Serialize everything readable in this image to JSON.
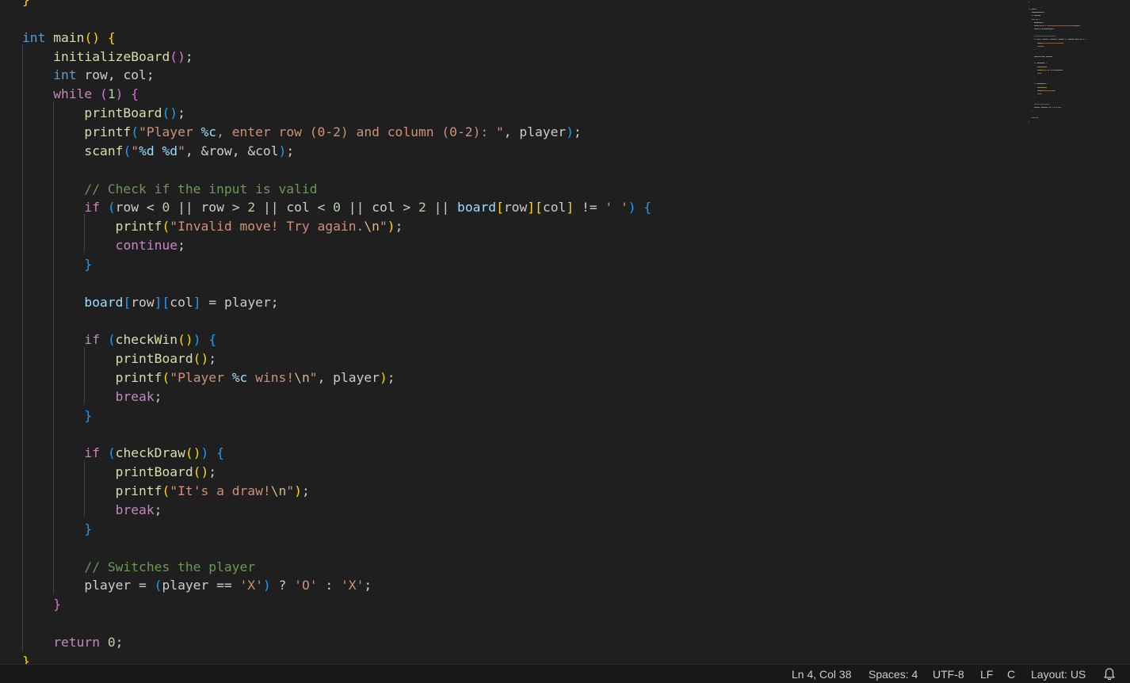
{
  "colors": {
    "keyword_type": "#569cd6",
    "control": "#c586c0",
    "function": "#dcdcaa",
    "variable": "#9cdcfe",
    "string": "#ce9178",
    "number": "#b5cea8",
    "comment": "#6a9955",
    "plain": "#cccccc",
    "bracket1": "#ffd700",
    "bracket2": "#da70d6",
    "bracket3": "#179fff",
    "escape": "#d7ba7d"
  },
  "editor": {
    "lines": [
      [
        [
          "}",
          "bracket1"
        ]
      ],
      [],
      [
        [
          "int",
          "keyword_type"
        ],
        [
          " ",
          "plain"
        ],
        [
          "main",
          "function"
        ],
        [
          "()",
          "bracket1"
        ],
        [
          " ",
          "plain"
        ],
        [
          "{",
          "bracket1"
        ]
      ],
      [
        [
          "    ",
          "plain"
        ],
        [
          "initializeBoard",
          "function"
        ],
        [
          "()",
          "bracket2"
        ],
        [
          ";",
          "plain"
        ]
      ],
      [
        [
          "    ",
          "plain"
        ],
        [
          "int",
          "keyword_type"
        ],
        [
          " row, col;",
          "plain"
        ]
      ],
      [
        [
          "    ",
          "plain"
        ],
        [
          "while",
          "control"
        ],
        [
          " ",
          "plain"
        ],
        [
          "(",
          "bracket2"
        ],
        [
          "1",
          "number"
        ],
        [
          ")",
          "bracket2"
        ],
        [
          " ",
          "plain"
        ],
        [
          "{",
          "bracket2"
        ]
      ],
      [
        [
          "        ",
          "plain"
        ],
        [
          "printBoard",
          "function"
        ],
        [
          "()",
          "bracket3"
        ],
        [
          ";",
          "plain"
        ]
      ],
      [
        [
          "        ",
          "plain"
        ],
        [
          "printf",
          "function"
        ],
        [
          "(",
          "bracket3"
        ],
        [
          "\"Player ",
          "string"
        ],
        [
          "%c",
          "variable"
        ],
        [
          ", enter row (0-2) and column (0-2): \"",
          "string"
        ],
        [
          ", player",
          "plain"
        ],
        [
          ")",
          "bracket3"
        ],
        [
          ";",
          "plain"
        ]
      ],
      [
        [
          "        ",
          "plain"
        ],
        [
          "scanf",
          "function"
        ],
        [
          "(",
          "bracket3"
        ],
        [
          "\"",
          "string"
        ],
        [
          "%d",
          "variable"
        ],
        [
          " ",
          "string"
        ],
        [
          "%d",
          "variable"
        ],
        [
          "\"",
          "string"
        ],
        [
          ", &row, &col",
          "plain"
        ],
        [
          ")",
          "bracket3"
        ],
        [
          ";",
          "plain"
        ]
      ],
      [],
      [
        [
          "        ",
          "plain"
        ],
        [
          "// Check if the input is valid",
          "comment"
        ]
      ],
      [
        [
          "        ",
          "plain"
        ],
        [
          "if",
          "control"
        ],
        [
          " ",
          "plain"
        ],
        [
          "(",
          "bracket3"
        ],
        [
          "row < ",
          "plain"
        ],
        [
          "0",
          "number"
        ],
        [
          " || row > ",
          "plain"
        ],
        [
          "2",
          "number"
        ],
        [
          " || col < ",
          "plain"
        ],
        [
          "0",
          "number"
        ],
        [
          " || col > ",
          "plain"
        ],
        [
          "2",
          "number"
        ],
        [
          " || ",
          "plain"
        ],
        [
          "board",
          "variable"
        ],
        [
          "[",
          "bracket1"
        ],
        [
          "row",
          "plain"
        ],
        [
          "]",
          "bracket1"
        ],
        [
          "[",
          "bracket1"
        ],
        [
          "col",
          "plain"
        ],
        [
          "]",
          "bracket1"
        ],
        [
          " != ",
          "plain"
        ],
        [
          "' '",
          "string"
        ],
        [
          ")",
          "bracket3"
        ],
        [
          " ",
          "plain"
        ],
        [
          "{",
          "bracket3"
        ]
      ],
      [
        [
          "            ",
          "plain"
        ],
        [
          "printf",
          "function"
        ],
        [
          "(",
          "bracket1"
        ],
        [
          "\"Invalid move! Try again.",
          "string"
        ],
        [
          "\\n",
          "escape"
        ],
        [
          "\"",
          "string"
        ],
        [
          ")",
          "bracket1"
        ],
        [
          ";",
          "plain"
        ]
      ],
      [
        [
          "            ",
          "plain"
        ],
        [
          "continue",
          "control"
        ],
        [
          ";",
          "plain"
        ]
      ],
      [
        [
          "        ",
          "plain"
        ],
        [
          "}",
          "bracket3"
        ]
      ],
      [],
      [
        [
          "        ",
          "plain"
        ],
        [
          "board",
          "variable"
        ],
        [
          "[",
          "bracket3"
        ],
        [
          "row",
          "plain"
        ],
        [
          "]",
          "bracket3"
        ],
        [
          "[",
          "bracket3"
        ],
        [
          "col",
          "plain"
        ],
        [
          "]",
          "bracket3"
        ],
        [
          " = player;",
          "plain"
        ]
      ],
      [],
      [
        [
          "        ",
          "plain"
        ],
        [
          "if",
          "control"
        ],
        [
          " ",
          "plain"
        ],
        [
          "(",
          "bracket3"
        ],
        [
          "checkWin",
          "function"
        ],
        [
          "()",
          "bracket1"
        ],
        [
          ")",
          "bracket3"
        ],
        [
          " ",
          "plain"
        ],
        [
          "{",
          "bracket3"
        ]
      ],
      [
        [
          "            ",
          "plain"
        ],
        [
          "printBoard",
          "function"
        ],
        [
          "()",
          "bracket1"
        ],
        [
          ";",
          "plain"
        ]
      ],
      [
        [
          "            ",
          "plain"
        ],
        [
          "printf",
          "function"
        ],
        [
          "(",
          "bracket1"
        ],
        [
          "\"Player ",
          "string"
        ],
        [
          "%c",
          "variable"
        ],
        [
          " wins!",
          "string"
        ],
        [
          "\\n",
          "escape"
        ],
        [
          "\"",
          "string"
        ],
        [
          ", player",
          "plain"
        ],
        [
          ")",
          "bracket1"
        ],
        [
          ";",
          "plain"
        ]
      ],
      [
        [
          "            ",
          "plain"
        ],
        [
          "break",
          "control"
        ],
        [
          ";",
          "plain"
        ]
      ],
      [
        [
          "        ",
          "plain"
        ],
        [
          "}",
          "bracket3"
        ]
      ],
      [],
      [
        [
          "        ",
          "plain"
        ],
        [
          "if",
          "control"
        ],
        [
          " ",
          "plain"
        ],
        [
          "(",
          "bracket3"
        ],
        [
          "checkDraw",
          "function"
        ],
        [
          "()",
          "bracket1"
        ],
        [
          ")",
          "bracket3"
        ],
        [
          " ",
          "plain"
        ],
        [
          "{",
          "bracket3"
        ]
      ],
      [
        [
          "            ",
          "plain"
        ],
        [
          "printBoard",
          "function"
        ],
        [
          "()",
          "bracket1"
        ],
        [
          ";",
          "plain"
        ]
      ],
      [
        [
          "            ",
          "plain"
        ],
        [
          "printf",
          "function"
        ],
        [
          "(",
          "bracket1"
        ],
        [
          "\"It's a draw!",
          "string"
        ],
        [
          "\\n",
          "escape"
        ],
        [
          "\"",
          "string"
        ],
        [
          ")",
          "bracket1"
        ],
        [
          ";",
          "plain"
        ]
      ],
      [
        [
          "            ",
          "plain"
        ],
        [
          "break",
          "control"
        ],
        [
          ";",
          "plain"
        ]
      ],
      [
        [
          "        ",
          "plain"
        ],
        [
          "}",
          "bracket3"
        ]
      ],
      [],
      [
        [
          "        ",
          "plain"
        ],
        [
          "// Switches the player",
          "comment"
        ]
      ],
      [
        [
          "        ",
          "plain"
        ],
        [
          "player = ",
          "plain"
        ],
        [
          "(",
          "bracket3"
        ],
        [
          "player == ",
          "plain"
        ],
        [
          "'X'",
          "string"
        ],
        [
          ")",
          "bracket3"
        ],
        [
          " ? ",
          "plain"
        ],
        [
          "'O'",
          "string"
        ],
        [
          " : ",
          "plain"
        ],
        [
          "'X'",
          "string"
        ],
        [
          ";",
          "plain"
        ]
      ],
      [
        [
          "    ",
          "plain"
        ],
        [
          "}",
          "bracket2"
        ]
      ],
      [],
      [
        [
          "    ",
          "plain"
        ],
        [
          "return",
          "control"
        ],
        [
          " ",
          "plain"
        ],
        [
          "0",
          "number"
        ],
        [
          ";",
          "plain"
        ]
      ],
      [
        [
          "}",
          "bracket1"
        ]
      ]
    ]
  },
  "status_bar": {
    "cursor_position": "Ln 4, Col 38",
    "indentation": "Spaces: 4",
    "encoding": "UTF-8",
    "line_ending": "LF",
    "language": "C",
    "keyboard_layout": "Layout: US",
    "notifications_icon": "bell-icon"
  }
}
